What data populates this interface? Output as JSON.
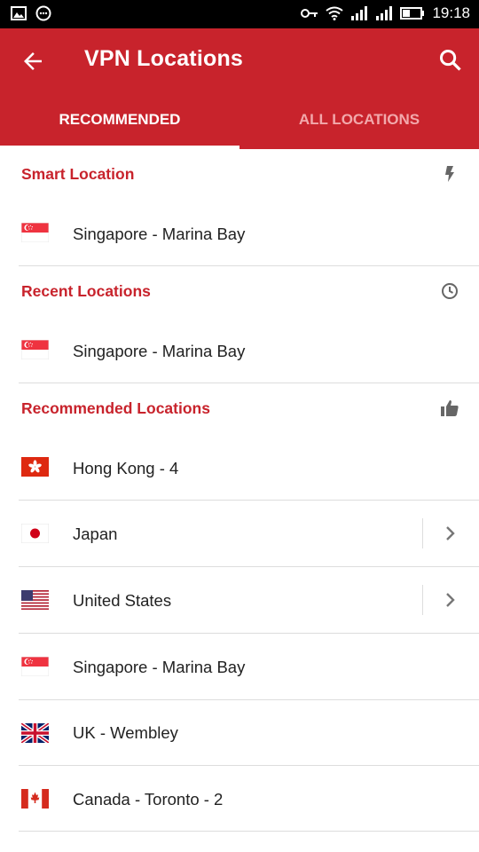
{
  "status_bar": {
    "time": "19:18",
    "left_icons": [
      "image-icon",
      "messenger-icon"
    ],
    "right_icons": [
      "vpn-key-icon",
      "wifi-icon",
      "signal-icon",
      "signal-icon",
      "battery-icon"
    ]
  },
  "app_bar": {
    "title": "VPN Locations",
    "back_icon": "arrow-back-icon",
    "search_icon": "search-icon",
    "color": "#c8232c"
  },
  "tabs": [
    {
      "label": "RECOMMENDED",
      "active": true
    },
    {
      "label": "ALL LOCATIONS",
      "active": false
    }
  ],
  "sections": {
    "smart": {
      "title": "Smart Location",
      "icon": "lightning-bolt-icon",
      "items": [
        {
          "name": "Singapore - Marina Bay",
          "flag": "singapore-flag"
        }
      ]
    },
    "recent": {
      "title": "Recent Locations",
      "icon": "clock-icon",
      "items": [
        {
          "name": "Singapore - Marina Bay",
          "flag": "singapore-flag"
        }
      ]
    },
    "recommended": {
      "title": "Recommended Locations",
      "icon": "thumbs-up-icon",
      "items": [
        {
          "name": "Hong Kong - 4",
          "flag": "hong-kong-flag",
          "expandable": false
        },
        {
          "name": "Japan",
          "flag": "japan-flag",
          "expandable": true
        },
        {
          "name": "United States",
          "flag": "usa-flag",
          "expandable": true
        },
        {
          "name": "Singapore - Marina Bay",
          "flag": "singapore-flag",
          "expandable": false
        },
        {
          "name": "UK - Wembley",
          "flag": "uk-flag",
          "expandable": false
        },
        {
          "name": "Canada - Toronto - 2",
          "flag": "canada-flag",
          "expandable": false
        }
      ]
    }
  }
}
